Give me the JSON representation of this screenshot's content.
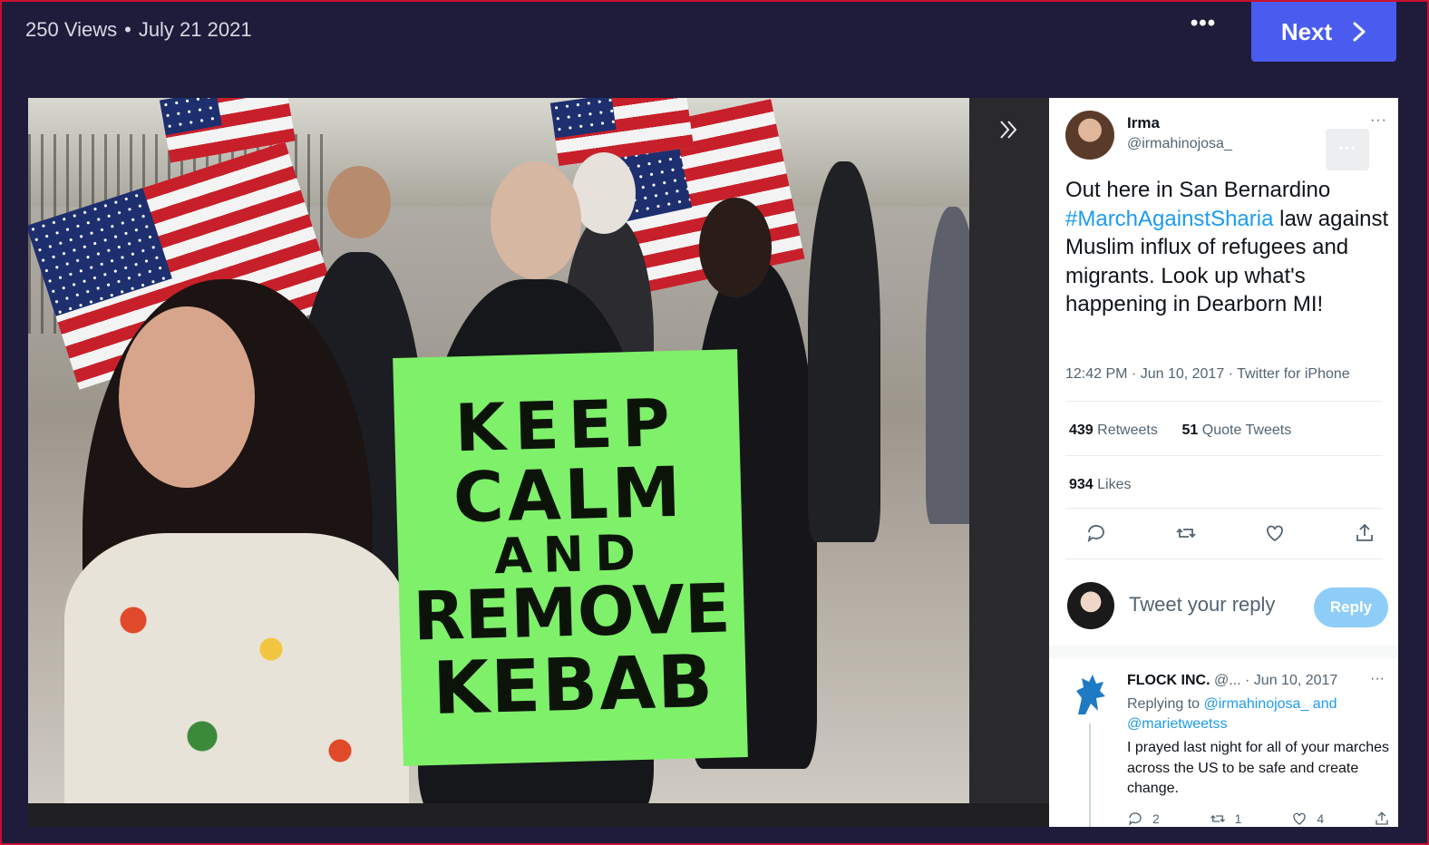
{
  "header": {
    "views": "250 Views",
    "separator": "•",
    "date": "July 21 2021",
    "more_label": "•••",
    "next_label": "Next"
  },
  "photo": {
    "sign_lines": [
      "KEEP",
      "CALM",
      "AND",
      "REMOVE",
      "KEBAB"
    ]
  },
  "tweet": {
    "name": "Irma",
    "handle": "@irmahinojosa_",
    "more": "···",
    "text_before": "Out here in San Bernardino ",
    "hashtag": "#MarchAgainstSharia",
    "text_after": " law against Muslim influx of refugees and migrants. Look up what's happening in Dearborn MI!",
    "meta": "12:42 PM · Jun 10, 2017 · Twitter for iPhone",
    "retweets_count": "439",
    "retweets_label": " Retweets",
    "quotes_count": "51",
    "quotes_label": " Quote Tweets",
    "likes_count": "934",
    "likes_label": " Likes",
    "reply_placeholder": "Tweet your reply",
    "reply_button": "Reply"
  },
  "reply_tweet": {
    "name": "FLOCK INC.",
    "handle": " @...",
    "date": " · Jun 10, 2017",
    "more": "···",
    "replying_to": "Replying to ",
    "mention1": "@irmahinojosa_",
    "and": " and ",
    "mention2": "@marietweetss",
    "body": "I prayed last night for all of your marches across the US to be safe and create change.",
    "replies": "2",
    "retweets": "1",
    "likes": "4"
  }
}
